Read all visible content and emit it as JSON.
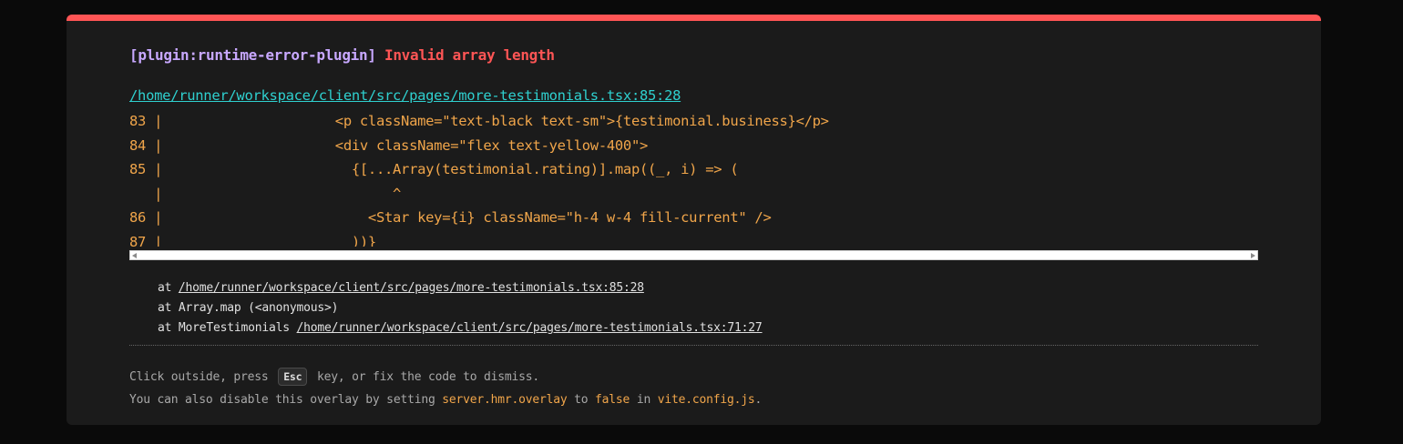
{
  "error": {
    "plugin": "[plugin:runtime-error-plugin]",
    "message": "Invalid array length",
    "file": "/home/runner/workspace/client/src/pages/more-testimonials.tsx:85:28"
  },
  "frame": {
    "lines": [
      "83 |                     <p className=\"text-black text-sm\">{testimonial.business}</p>",
      "84 |                     <div className=\"flex text-yellow-400\">",
      "85 |                       {[...Array(testimonial.rating)].map((_, i) => (",
      "   |                            ^",
      "86 |                         <Star key={i} className=\"h-4 w-4 fill-current\" />",
      "87 |                       ))}"
    ]
  },
  "stack": [
    {
      "prefix": "at ",
      "link": "/home/runner/workspace/client/src/pages/more-testimonials.tsx:85:28"
    },
    {
      "prefix": "at Array.map (<anonymous>)",
      "link": ""
    },
    {
      "prefix": "at MoreTestimonials ",
      "link": "/home/runner/workspace/client/src/pages/more-testimonials.tsx:71:27"
    }
  ],
  "tip": {
    "line1_before": "Click outside, press",
    "key": "Esc",
    "line1_after": "key, or fix the code to dismiss.",
    "line2_part1": "You can also disable this overlay by setting",
    "code1": "server.hmr.overlay",
    "line2_part2": "to",
    "code2": "false",
    "line2_part3": "in",
    "code3": "vite.config.js",
    "line2_end": "."
  },
  "colors": {
    "accent_error": "#ff5555",
    "plugin": "#c8a8ff",
    "link": "#2fd0cf",
    "code": "#f0a54a",
    "background": "#1b1b1b"
  }
}
